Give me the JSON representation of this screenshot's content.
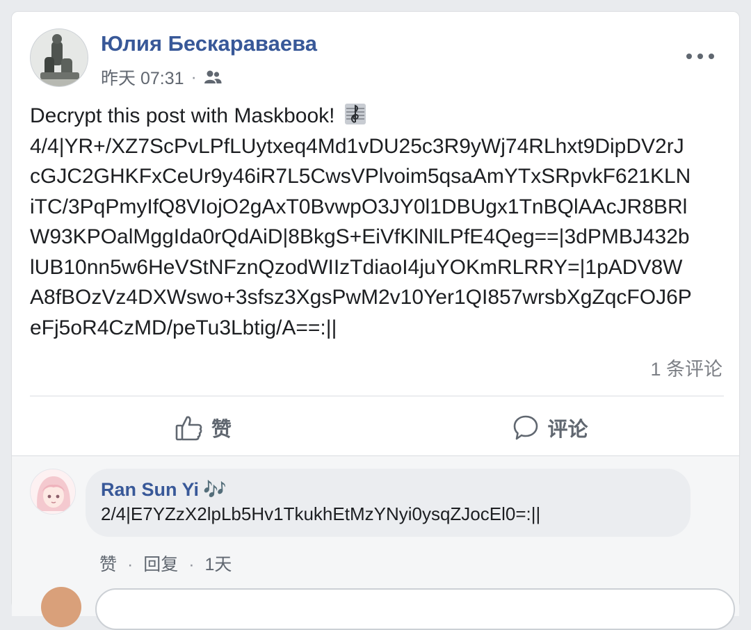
{
  "post": {
    "author": "Юлия Бескараваева",
    "time": "昨天 07:31",
    "separator": "·",
    "audience_icon": "friends-icon",
    "body_lines": [
      "Decrypt this post with Maskbook!",
      "4/4|YR+/XZ7ScPvLPfLUytxeq4Md1vDU25c3R9yWj74RLhxt9DipDV2rJ",
      "cGJC2GHKFxCeUr9y46iR7L5CwsVPlvoim5qsaAmYTxSRpvkF621KLN",
      "iTC/3PqPmyIfQ8VIojO2gAxT0BvwpO3JY0l1DBUgx1TnBQlAAcJR8BRl",
      "W93KPOalMggIda0rQdAiD|8BkgS+EiVfKlNlLPfE4Qeg==|3dPMBJ432b",
      "lUB10nn5w6HeVStNFznQzodWIIzTdiaoI4juYOKmRLRRY=|1pADV8W",
      "A8fBOzVz4DXWswo+3sfsz3XgsPwM2v10Yer1QI857wrsbXgZqcFOJ6P",
      "eFj5oR4CzMD/peTu3Lbtig/A==:||"
    ],
    "comment_count": "1 条评论"
  },
  "actions": {
    "like_label": "赞",
    "comment_label": "评论"
  },
  "comment": {
    "author": "Ran Sun Yi",
    "author_suffix": "🎶",
    "text": "2/4|E7YZzX2lpLb5Hv1TkukhEtMzYNyi0ysqZJocEl0=:||",
    "like_label": "赞",
    "reply_label": "回复",
    "age": "1天",
    "dot": "·"
  },
  "colors": {
    "link": "#385898",
    "text": "#1c1e21",
    "muted": "#606770",
    "background": "#e9ebee"
  }
}
